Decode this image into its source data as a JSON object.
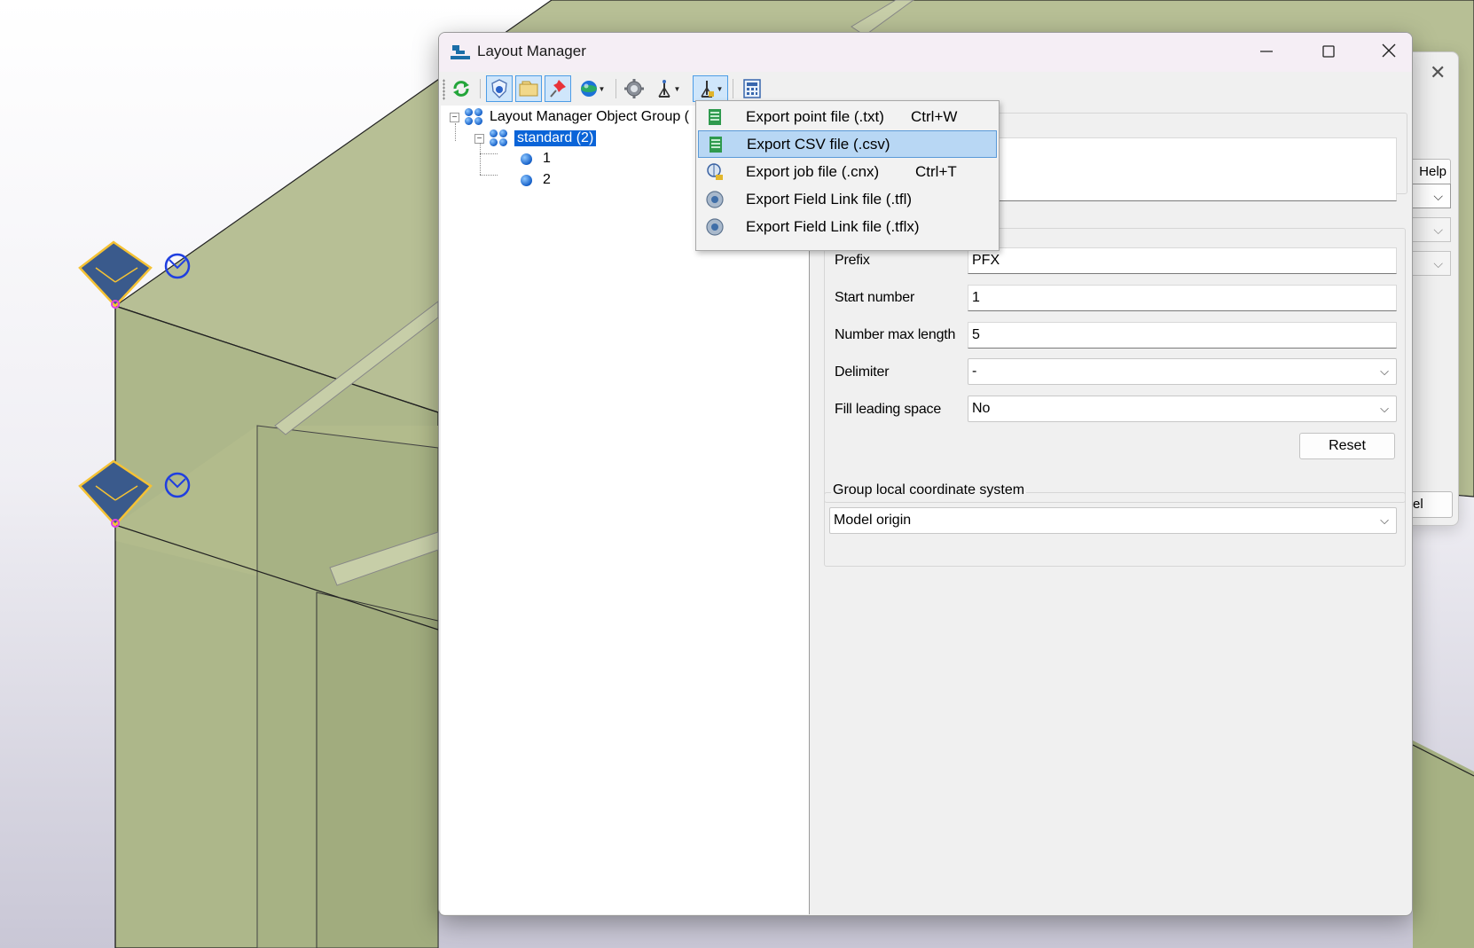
{
  "window": {
    "title": "Layout Manager",
    "controls": {
      "minimize": "—",
      "maximize": "☐",
      "close": "✕"
    }
  },
  "toolbar": {
    "tools": [
      "refresh-icon",
      "shield-icon",
      "folder-icon",
      "pin-icon",
      "globe-icon",
      "gear-icon",
      "stakeout-icon",
      "export-icon",
      "calculator-icon"
    ]
  },
  "tree": {
    "root": "Layout Manager Object Group (",
    "group": "standard (2)",
    "points": [
      "1",
      "2"
    ]
  },
  "menu": {
    "items": [
      {
        "label": "Export point file (.txt)",
        "shortcut": "Ctrl+W",
        "icon": "text-file-icon"
      },
      {
        "label": "Export CSV file (.csv)",
        "shortcut": "",
        "icon": "csv-file-icon",
        "highlighted": true
      },
      {
        "label": "Export job file (.cnx)",
        "shortcut": "Ctrl+T",
        "icon": "job-file-icon"
      },
      {
        "label": "Export Field Link file (.tfl)",
        "shortcut": "",
        "icon": "fieldlink-icon"
      },
      {
        "label": "Export Field Link file (.tflx)",
        "shortcut": "",
        "icon": "fieldlink-icon"
      }
    ]
  },
  "properties": {
    "prefix_label": "Prefix",
    "prefix_value": "PFX",
    "start_label": "Start number",
    "start_value": "1",
    "maxlen_label": "Number max length",
    "maxlen_value": "5",
    "delimiter_label": "Delimiter",
    "delimiter_value": "-",
    "fill_label": "Fill leading space",
    "fill_value": "No",
    "reset_label": "Reset",
    "coord_group_title": "Group local coordinate system",
    "coord_value": "Model origin"
  },
  "background_window": {
    "help_label": "Help",
    "cancel_label": "el"
  },
  "colors": {
    "model_fill": "#b3bb8f",
    "selection": "#0a64d8",
    "menu_highlight": "#b8d7f4"
  }
}
